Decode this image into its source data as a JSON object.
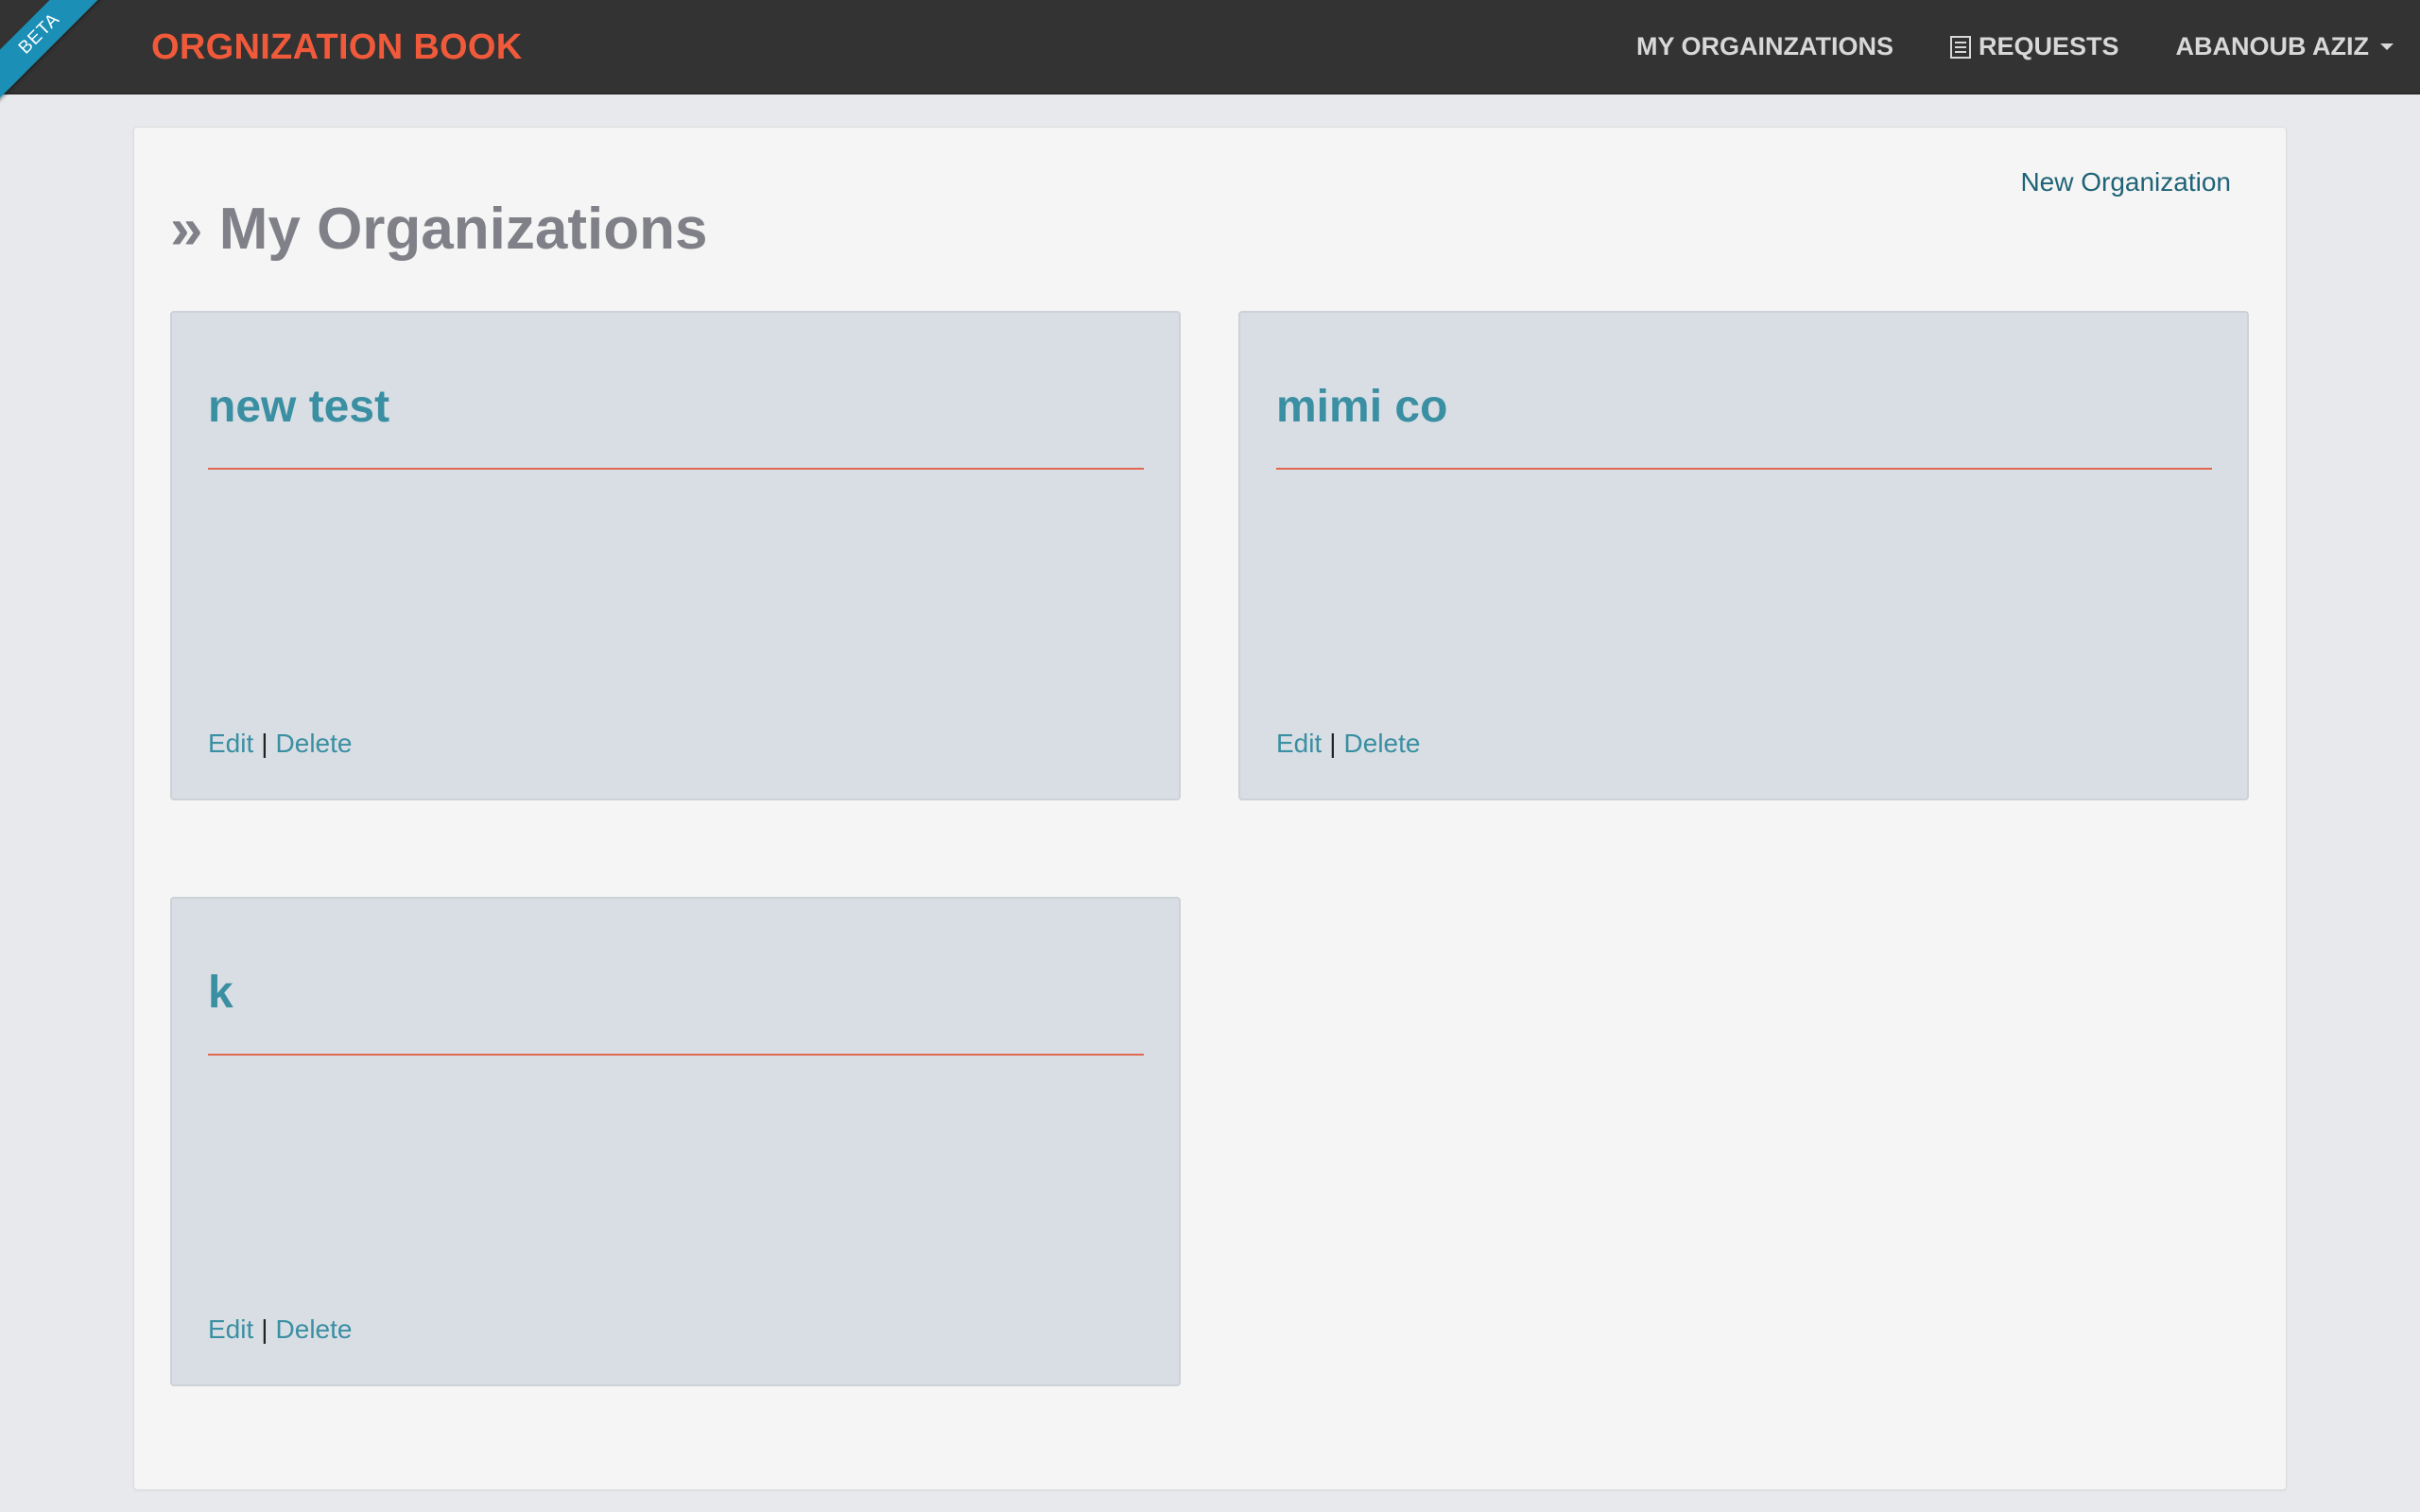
{
  "ribbon": {
    "label": "BETA"
  },
  "navbar": {
    "brand": "ORGNIZATION BOOK",
    "links": [
      {
        "label": "MY ORGAINZATIONS"
      },
      {
        "label": "REQUESTS",
        "icon": "list-icon"
      },
      {
        "label": "ABANOUB AZIZ",
        "icon": "caret-down-icon"
      }
    ]
  },
  "main": {
    "new_org_label": "New Organization",
    "title_prefix": "»",
    "title": "My Organizations",
    "organizations": [
      {
        "name": "new test",
        "edit_label": "Edit",
        "separator": "|",
        "delete_label": "Delete"
      },
      {
        "name": "mimi co",
        "edit_label": "Edit",
        "separator": "|",
        "delete_label": "Delete"
      },
      {
        "name": "k",
        "edit_label": "Edit",
        "separator": "|",
        "delete_label": "Delete"
      }
    ]
  },
  "colors": {
    "brand": "#f05a3a",
    "navbar_bg": "#333333",
    "ribbon": "#1b8fb5",
    "card_title": "#3a8fa2",
    "card_rule": "#e2674f",
    "card_bg": "#d9dee4"
  }
}
